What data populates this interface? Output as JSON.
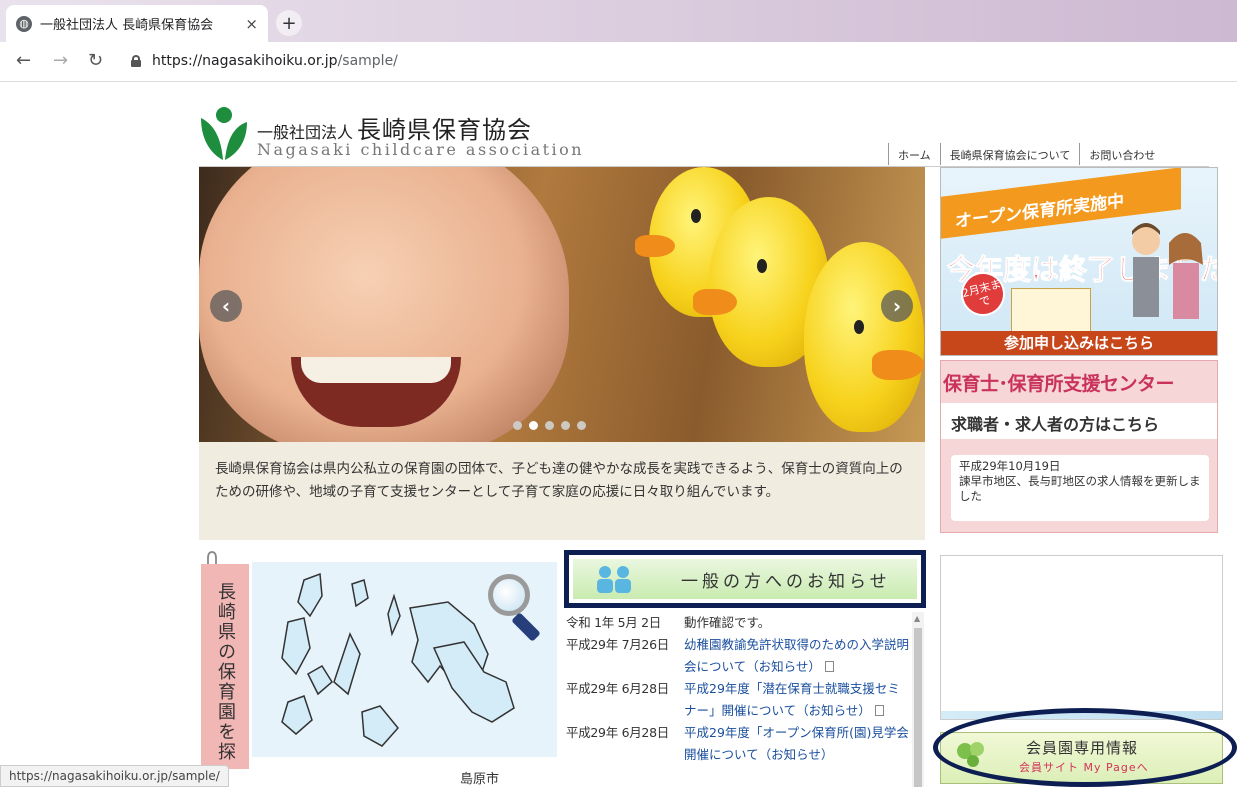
{
  "browser": {
    "tab_title": "一般社団法人 長崎県保育協会",
    "tab_close": "×",
    "new_tab": "+",
    "url_host": "https://nagasakihoiku.or.jp",
    "url_path": "/sample/",
    "status_url": "https://nagasakihoiku.or.jp/sample/"
  },
  "header": {
    "org_prefix": "一般社団法人",
    "org_name": "長崎県保育協会",
    "org_english": "Nagasaki childcare association",
    "nav": [
      "ホーム",
      "長崎県保育協会について",
      "お問い合わせ"
    ]
  },
  "hero": {
    "prev": "‹",
    "next": "›",
    "dot_count": 5,
    "active_dot": 1
  },
  "intro": {
    "text": "長崎県保育協会は県内公私立の保育園の団体で、子ども達の健やかな成長を実践できるよう、保育士の資質向上のための研修や、地域の子育て支援センターとして子育て家庭の応援に日々取り組んでいます。"
  },
  "sidebar": {
    "open_nursery": {
      "headline": "オープン保育所実施中",
      "ended": "今年度は終了しました",
      "badge": "2月末まで",
      "apply": "参加申し込みはこちら"
    },
    "support_center": {
      "title": "保育士･保育所支援センター",
      "subtitle": "求職者・求人者の方はこちら",
      "news_date": "平成29年10月19日",
      "news_text": "諫早市地区、長与町地区の求人情報を更新しました"
    },
    "member": {
      "title": "会員園専用情報",
      "link": "会員サイト My Pageへ"
    }
  },
  "prefmap": {
    "label": "長崎県の保育園を探",
    "bottom_text": "島原市"
  },
  "notices": {
    "heading": "一般の方へのお知らせ",
    "items": [
      {
        "date": "令和 1年 5月 2日",
        "text": "動作確認です。",
        "doc": false
      },
      {
        "date": "平成29年 7月26日",
        "text": "幼稚園教諭免許状取得のための入学説明会について（お知らせ）",
        "doc": true
      },
      {
        "date": "平成29年 6月28日",
        "text": "平成29年度「潜在保育士就職支援セミナー」開催について（お知らせ）",
        "doc": true
      },
      {
        "date": "平成29年 6月28日",
        "text": "平成29年度「オープン保育所(園)見学会開催について（お知らせ）",
        "doc": false
      }
    ]
  },
  "colors": {
    "highlight_border": "#0d1e52",
    "pink_panel": "#f7d6d8",
    "link_blue": "#1a4f9e",
    "intro_bg": "#f1ece0"
  }
}
